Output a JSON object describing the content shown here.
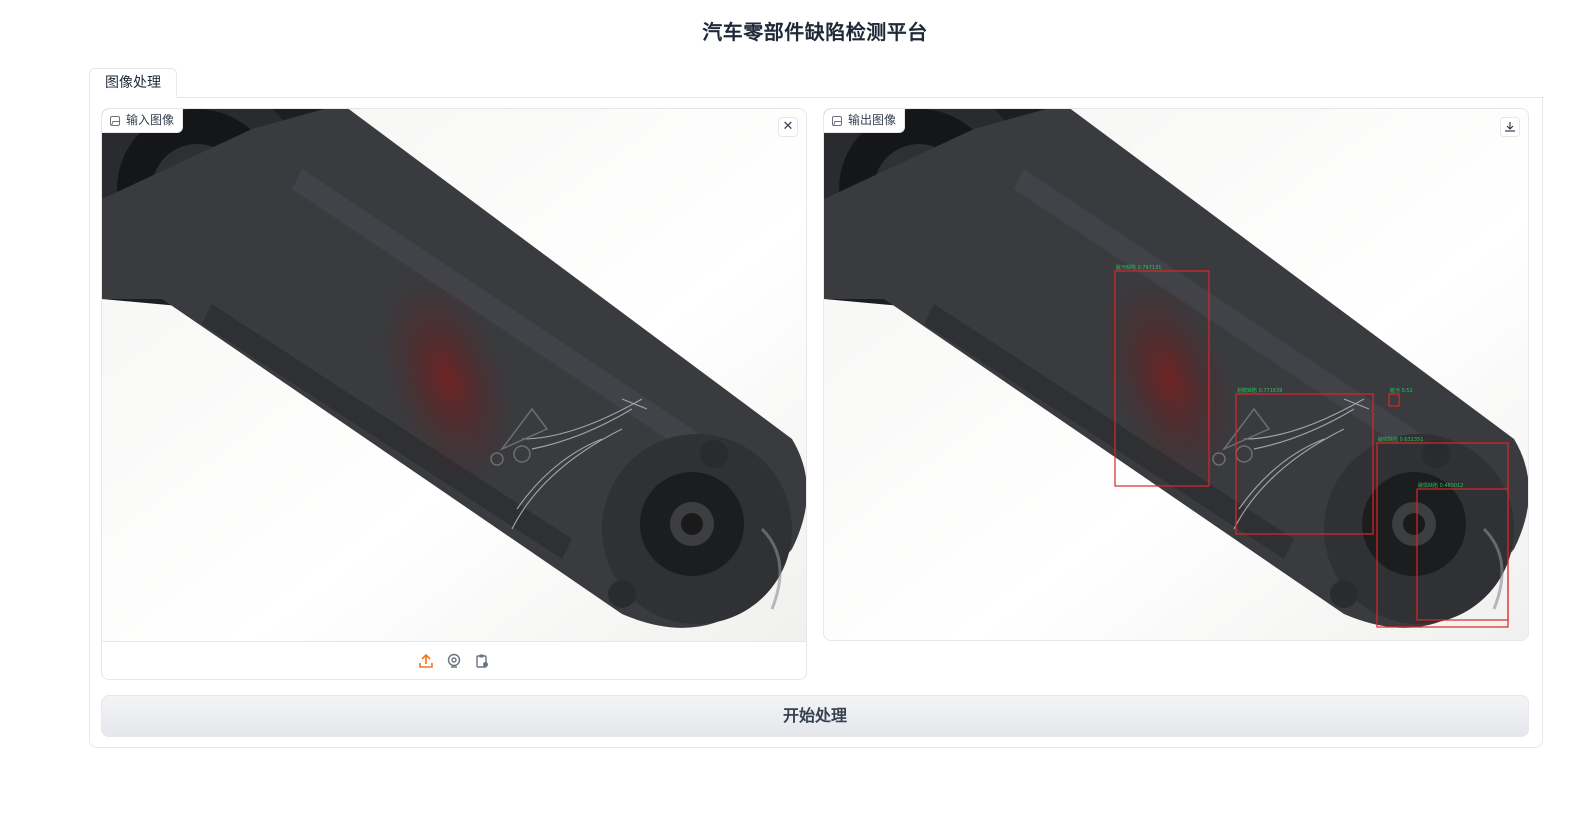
{
  "app": {
    "title": "汽车零部件缺陷检测平台"
  },
  "tabs": [
    {
      "label": "图像处理",
      "active": true
    }
  ],
  "input_image": {
    "label": "输入图像",
    "clear_icon": "close-icon",
    "sources": [
      "upload-icon",
      "webcam-icon",
      "clipboard-icon"
    ]
  },
  "output_image": {
    "label": "输出图像",
    "download_icon": "download-icon",
    "detections": [
      {
        "label": "脏污缺陷 0.797131"
      },
      {
        "label": "划痕缺陷 0.771639"
      },
      {
        "label": "脏污 0.52"
      },
      {
        "label": "破损缺陷 0.631351"
      },
      {
        "label": "破损缺陷 0.480012"
      }
    ]
  },
  "actions": {
    "run_label": "开始处理"
  },
  "colors": {
    "accent": "#f97316",
    "box": "#dc2626",
    "box_label": "#22c55e"
  }
}
